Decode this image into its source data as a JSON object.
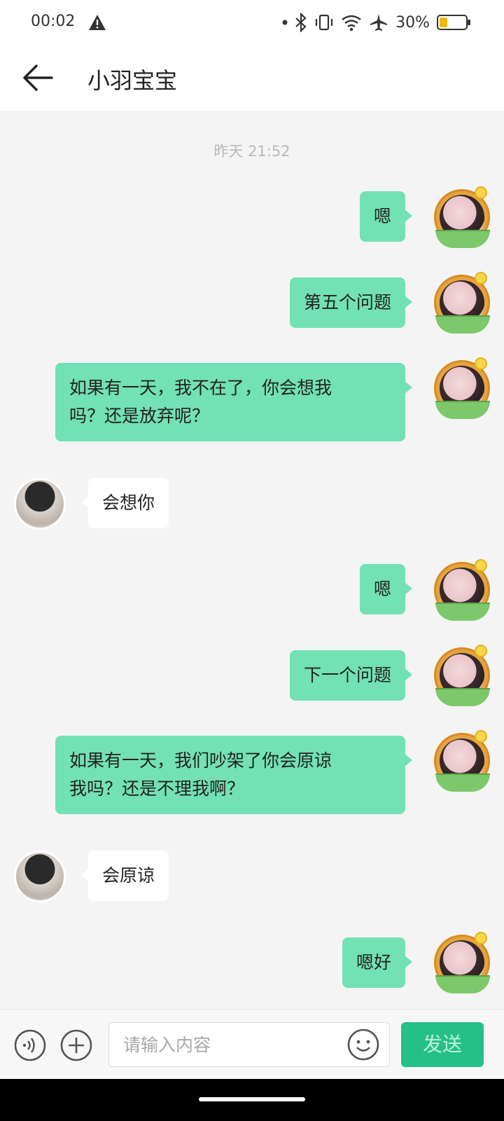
{
  "status_bar": {
    "time": "00:02",
    "battery_percent": "30%",
    "battery_level": 0.3,
    "icons": [
      "alert-icon",
      "dot-icon",
      "bluetooth-icon",
      "vibrate-icon",
      "wifi-icon",
      "airplane-icon",
      "battery-icon"
    ]
  },
  "header": {
    "title": "小羽宝宝",
    "back_icon": "arrow-left-icon"
  },
  "chat": {
    "timestamp": "昨天 21:52",
    "messages": [
      {
        "side": "out",
        "text": "嗯"
      },
      {
        "side": "out",
        "text": "第五个问题"
      },
      {
        "side": "out",
        "line1": "如果有一天，我不在了，你会想我",
        "line2": "吗？还是放弃呢？"
      },
      {
        "side": "in",
        "text": "会想你"
      },
      {
        "side": "out",
        "text": "嗯"
      },
      {
        "side": "out",
        "text": "下一个问题"
      },
      {
        "side": "out",
        "line1": "如果有一天，我们吵架了你会原谅",
        "line2": "我吗？还是不理我啊？"
      },
      {
        "side": "in",
        "text": "会原谅"
      },
      {
        "side": "out",
        "text": "嗯好"
      }
    ]
  },
  "input_bar": {
    "voice_icon": "voice-icon",
    "plus_icon": "plus-icon",
    "placeholder": "请输入内容",
    "emoji_icon": "emoji-icon",
    "send_label": "发送"
  },
  "colors": {
    "out_bubble": "#72e1b4",
    "in_bubble": "#ffffff",
    "send_button": "#25c08a",
    "background": "#f4f4f4"
  }
}
